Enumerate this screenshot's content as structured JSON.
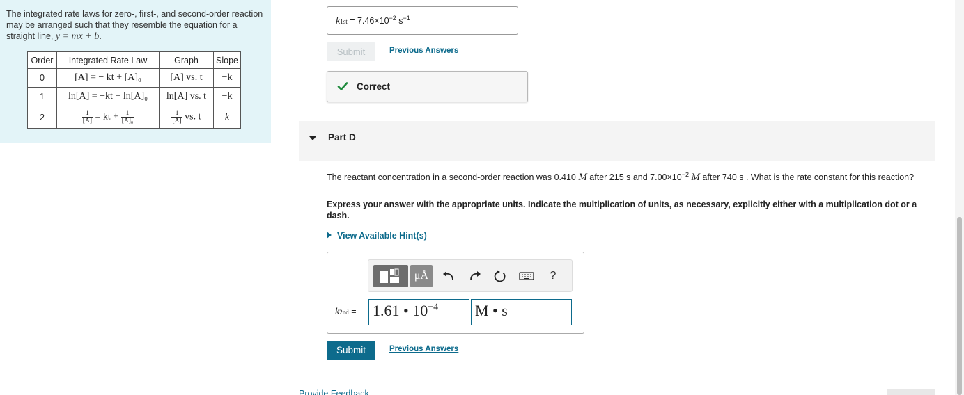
{
  "intro": {
    "text_before_eq": "The integrated rate laws for zero-, first-, and second-order reaction may be arranged such that they resemble the equation for a straight line, ",
    "equation": "y = mx + b",
    "text_after_eq": "."
  },
  "rate_table": {
    "headers": [
      "Order",
      "Integrated Rate Law",
      "Graph",
      "Slope"
    ],
    "rows": [
      {
        "order": "0",
        "law": "[A] = − kt + [A]₀",
        "graph": "[A] vs. t",
        "slope": "−k"
      },
      {
        "order": "1",
        "law": "ln[A] = −kt + ln[A]₀",
        "graph": "ln[A] vs. t",
        "slope": "−k"
      },
      {
        "order": "2",
        "law_mid": "= kt +",
        "frac1_num": "1",
        "frac1_den": "[A]",
        "frac2_num": "1",
        "frac2_den": "[A]₀",
        "graph_num": "1",
        "graph_den": "[A]",
        "graph_tail": "vs. t",
        "slope": "k"
      }
    ]
  },
  "part_c": {
    "answer_label": "k",
    "answer_label_sub": "1st",
    "answer_eq": " = ",
    "answer_value": "7.46×10",
    "answer_exp": "−2",
    "answer_unit": " s",
    "answer_unit_exp": "−1",
    "submit_label": "Submit",
    "previous_answers": "Previous Answers",
    "correct_label": "Correct"
  },
  "part_d": {
    "title": "Part D",
    "question_p1": "The reactant concentration in a second-order reaction was 0.410 ",
    "unit_M": "M",
    "question_p2": " after 215 s and 7.00×10",
    "question_exp": "−2",
    "question_p3": " after 740 s . What is the rate constant for this reaction?",
    "instructions": "Express your answer with the appropriate units. Indicate the multiplication of units, as necessary, explicitly either with a multiplication dot or a dash.",
    "hints_label": "View Available Hint(s)",
    "toolbar": {
      "units_label": "μÅ",
      "help_label": "?"
    },
    "answer_label": "k",
    "answer_label_sub": "2nd",
    "answer_eq": " =",
    "value_text": "1.61 • 10",
    "value_exp": "−4",
    "units_text": "M • s",
    "submit_label": "Submit",
    "previous_answers": "Previous Answers"
  },
  "footer": {
    "feedback_link": "Provide Feedback"
  },
  "colors": {
    "accent": "#0d6b8c",
    "info_bg": "#e3f4f8",
    "correct_green": "#1e8a3c"
  }
}
